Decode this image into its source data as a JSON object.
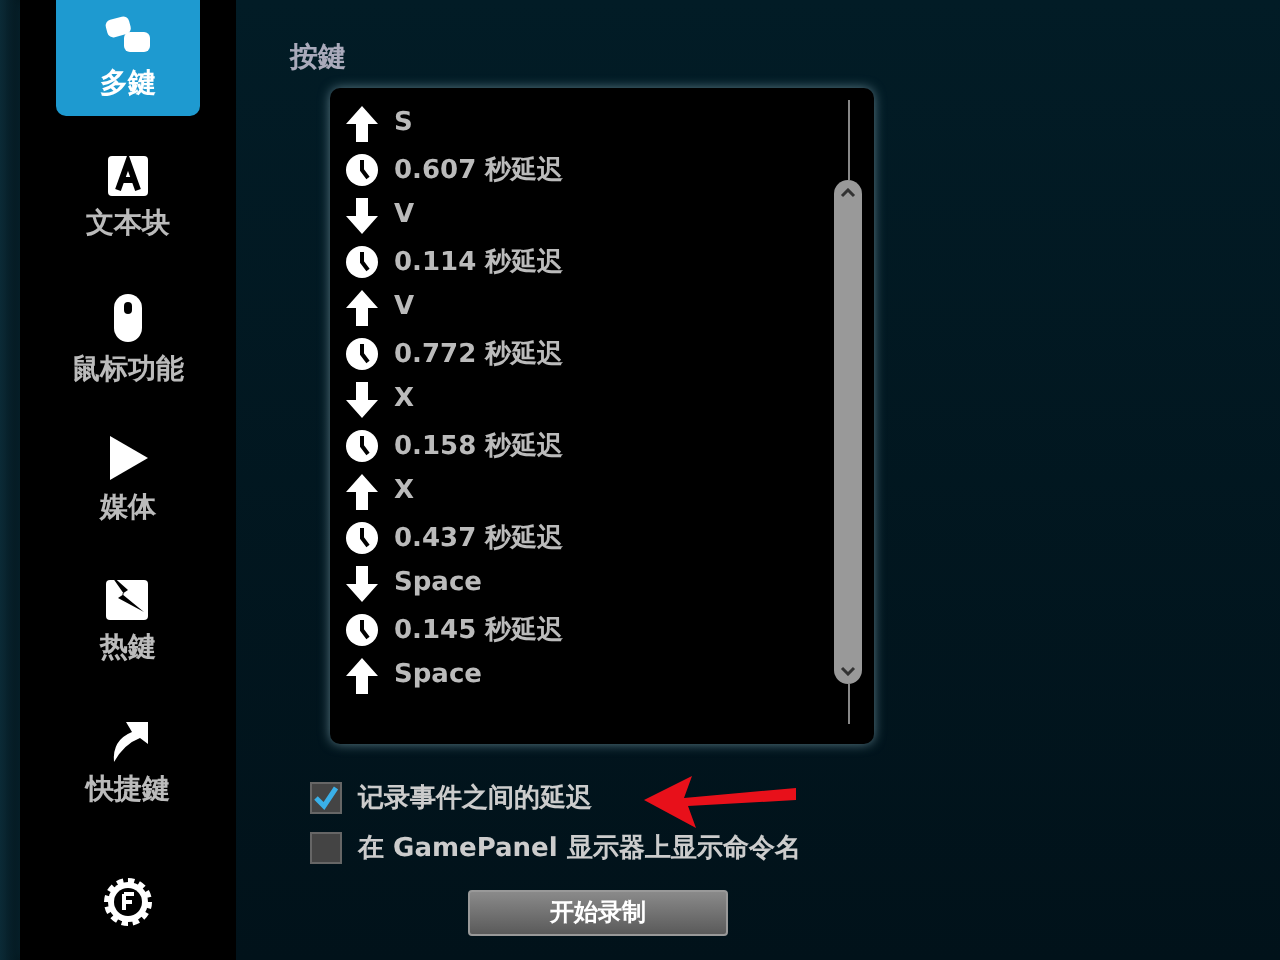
{
  "sidebar": {
    "items": [
      {
        "kind": "keys",
        "label": "多鍵",
        "selected": true
      },
      {
        "kind": "text",
        "label": "文本块",
        "selected": false
      },
      {
        "kind": "mouse",
        "label": "鼠标功能",
        "selected": false
      },
      {
        "kind": "media",
        "label": "媒体",
        "selected": false
      },
      {
        "kind": "hotkey",
        "label": "热鍵",
        "selected": false
      },
      {
        "kind": "shortcut",
        "label": "快捷鍵",
        "selected": false
      },
      {
        "kind": "gear",
        "selected": false
      }
    ]
  },
  "section_title": "按鍵",
  "events": [
    {
      "kind": "up",
      "text": "S"
    },
    {
      "kind": "delay",
      "text": "0.607 秒延迟"
    },
    {
      "kind": "down",
      "text": "V"
    },
    {
      "kind": "delay",
      "text": "0.114 秒延迟"
    },
    {
      "kind": "up",
      "text": "V"
    },
    {
      "kind": "delay",
      "text": "0.772 秒延迟"
    },
    {
      "kind": "down",
      "text": "X"
    },
    {
      "kind": "delay",
      "text": "0.158 秒延迟"
    },
    {
      "kind": "up",
      "text": "X"
    },
    {
      "kind": "delay",
      "text": "0.437 秒延迟"
    },
    {
      "kind": "down",
      "text": "Space"
    },
    {
      "kind": "delay",
      "text": "0.145 秒延迟"
    },
    {
      "kind": "up",
      "text": "Space"
    }
  ],
  "options": [
    {
      "label": "记录事件之间的延迟",
      "checked": true
    },
    {
      "label": "在 GamePanel 显示器上显示命令名",
      "checked": false
    }
  ],
  "record_button": "开始录制"
}
